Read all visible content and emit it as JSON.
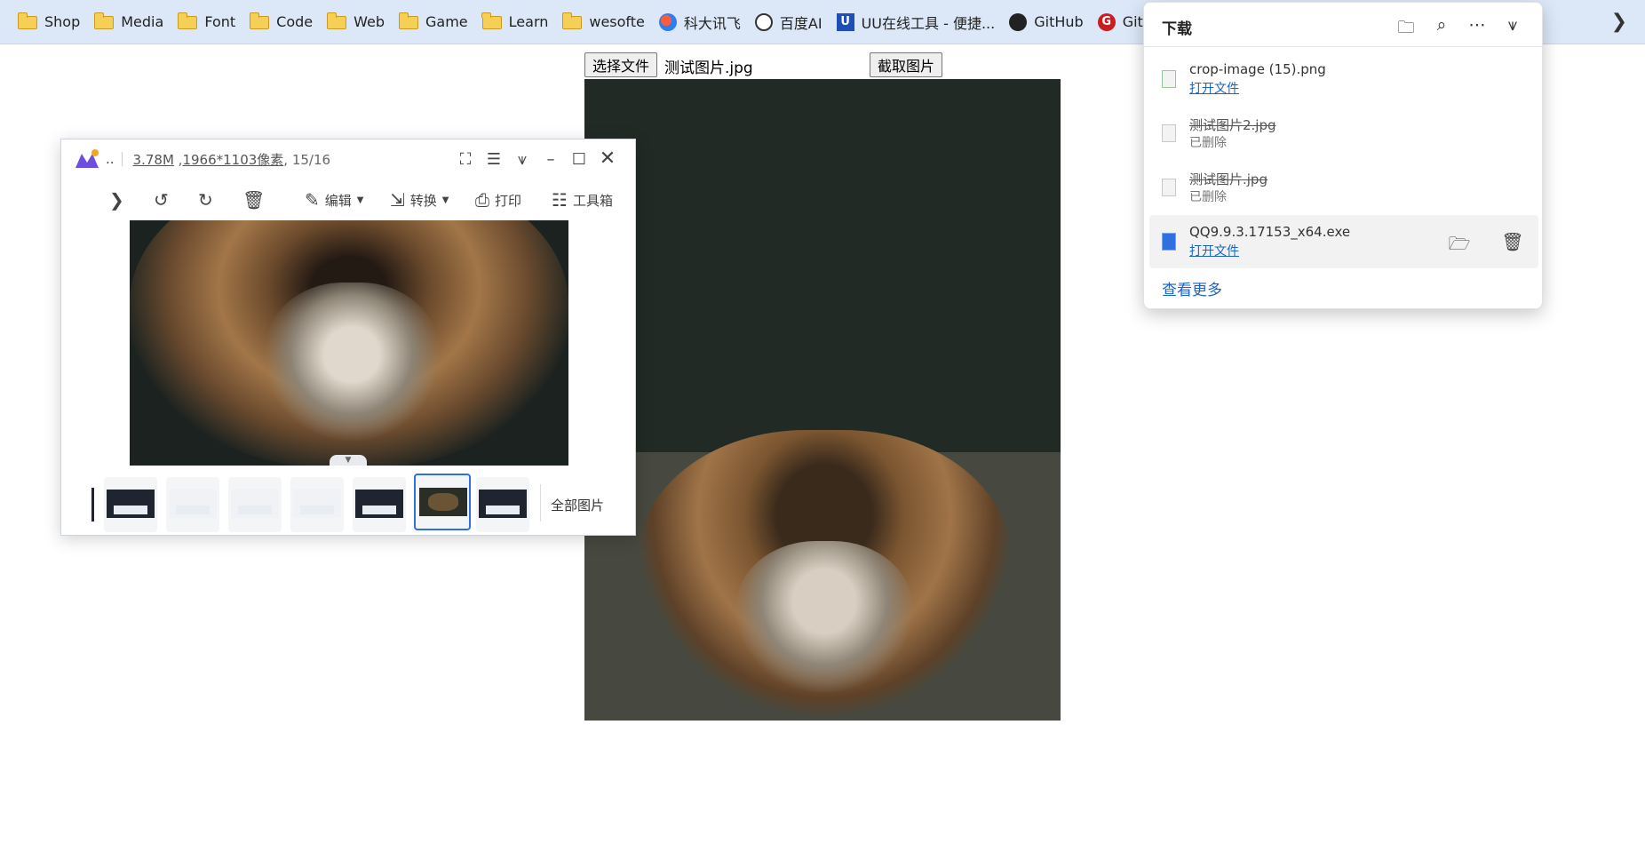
{
  "bookmarks": [
    {
      "label": "Shop",
      "icon": "folder-icon"
    },
    {
      "label": "Media",
      "icon": "folder-icon"
    },
    {
      "label": "Font",
      "icon": "folder-icon"
    },
    {
      "label": "Code",
      "icon": "folder-icon"
    },
    {
      "label": "Web",
      "icon": "folder-icon"
    },
    {
      "label": "Game",
      "icon": "folder-icon"
    },
    {
      "label": "Learn",
      "icon": "folder-icon"
    },
    {
      "label": "wesofte",
      "icon": "folder-icon"
    },
    {
      "label": "科大讯飞",
      "icon": "iflytek-icon"
    },
    {
      "label": "百度AI",
      "icon": "baidu-ai-icon"
    },
    {
      "label": "UU在线工具 - 便捷...",
      "icon": "uu-tools-icon"
    },
    {
      "label": "GitHub",
      "icon": "github-icon"
    },
    {
      "label": "Gitee",
      "icon": "gitee-icon"
    }
  ],
  "page": {
    "choose_file_label": "选择文件",
    "file_name": "测试图片.jpg",
    "capture_label": "截取图片"
  },
  "viewer": {
    "title_dots": "..",
    "file_size": "3.78M",
    "dimensions": "1966*1103像素",
    "position": ", 15/16",
    "toolbar": {
      "edit": "编辑",
      "convert": "转换",
      "print": "打印",
      "toolbox": "工具箱"
    },
    "all_pictures": "全部图片"
  },
  "downloads": {
    "title": "下载",
    "items": [
      {
        "name": "crop-image (15).png",
        "action": "打开文件",
        "deleted": false
      },
      {
        "name": "测试图片2.jpg",
        "status": "已删除",
        "deleted": true
      },
      {
        "name": "测试图片.jpg",
        "status": "已删除",
        "deleted": true
      },
      {
        "name": "QQ9.9.3.17153_x64.exe",
        "action": "打开文件",
        "deleted": false
      }
    ],
    "see_more": "查看更多"
  },
  "colors": {
    "bookmark_bar": "#dce8f8",
    "link": "#1a64c8",
    "selected_thumb": "#2f6fe0"
  }
}
